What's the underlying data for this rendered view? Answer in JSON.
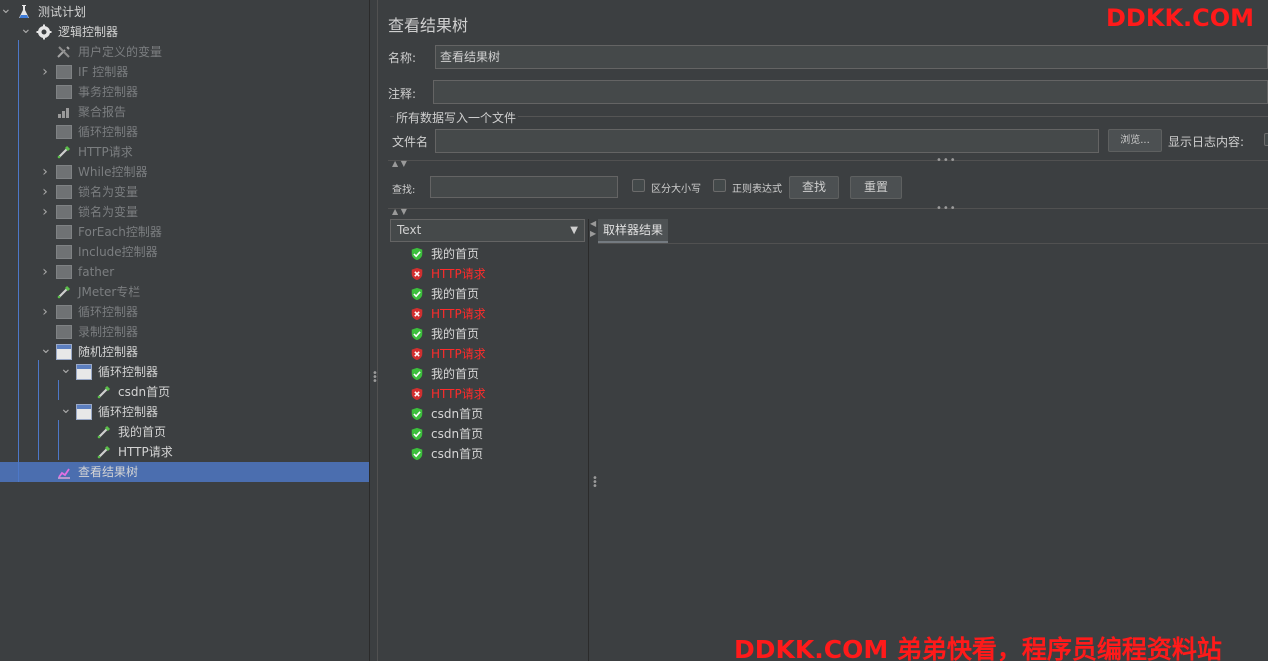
{
  "tree": {
    "items": [
      {
        "label": "测试计划",
        "level": 0,
        "expanded": true,
        "icon": "flask-icon",
        "style": "bright"
      },
      {
        "label": "逻辑控制器",
        "level": 1,
        "expanded": true,
        "icon": "gear-icon",
        "style": "bright"
      },
      {
        "label": "用户定义的变量",
        "level": 2,
        "expandable": false,
        "icon": "wrench-icon",
        "style": "dim"
      },
      {
        "label": "IF 控制器",
        "level": 2,
        "expandable": true,
        "expanded": false,
        "icon": "box-icon",
        "style": "dim"
      },
      {
        "label": "事务控制器",
        "level": 2,
        "expandable": false,
        "icon": "box-icon",
        "style": "dim"
      },
      {
        "label": "聚合报告",
        "level": 2,
        "expandable": false,
        "icon": "chart-icon",
        "style": "dim"
      },
      {
        "label": "循环控制器",
        "level": 2,
        "expandable": false,
        "icon": "box-icon",
        "style": "dim"
      },
      {
        "label": "HTTP请求",
        "level": 2,
        "expandable": false,
        "icon": "pipette-icon",
        "style": "dim"
      },
      {
        "label": "While控制器",
        "level": 2,
        "expandable": true,
        "expanded": false,
        "icon": "box-icon",
        "style": "dim"
      },
      {
        "label": "锁名为变量",
        "level": 2,
        "expandable": true,
        "expanded": false,
        "icon": "box-icon",
        "style": "dim"
      },
      {
        "label": "锁名为变量",
        "level": 2,
        "expandable": true,
        "expanded": false,
        "icon": "box-icon",
        "style": "dim"
      },
      {
        "label": "ForEach控制器",
        "level": 2,
        "expandable": false,
        "icon": "box-icon",
        "style": "dim"
      },
      {
        "label": "Include控制器",
        "level": 2,
        "expandable": false,
        "icon": "box-icon",
        "style": "dim"
      },
      {
        "label": "father",
        "level": 2,
        "expandable": true,
        "expanded": false,
        "icon": "box-icon",
        "style": "dim"
      },
      {
        "label": "JMeter专栏",
        "level": 2,
        "expandable": false,
        "icon": "pipette-icon",
        "style": "dim"
      },
      {
        "label": "循环控制器",
        "level": 2,
        "expandable": true,
        "expanded": false,
        "icon": "box-icon",
        "style": "dim"
      },
      {
        "label": "录制控制器",
        "level": 2,
        "expandable": false,
        "icon": "box-icon",
        "style": "dim"
      },
      {
        "label": "随机控制器",
        "level": 2,
        "expandable": true,
        "expanded": true,
        "icon": "window-icon",
        "style": "bright"
      },
      {
        "label": "循环控制器",
        "level": 3,
        "expandable": true,
        "expanded": true,
        "icon": "window-icon",
        "style": "bright"
      },
      {
        "label": "csdn首页",
        "level": 4,
        "expandable": false,
        "icon": "pipette-icon",
        "style": "bright"
      },
      {
        "label": "循环控制器",
        "level": 3,
        "expandable": true,
        "expanded": true,
        "icon": "window-icon",
        "style": "bright"
      },
      {
        "label": "我的首页",
        "level": 4,
        "expandable": false,
        "icon": "pipette-icon",
        "style": "bright"
      },
      {
        "label": "HTTP请求",
        "level": 4,
        "expandable": false,
        "icon": "pipette-icon",
        "style": "bright"
      },
      {
        "label": "查看结果树",
        "level": 2,
        "expandable": false,
        "icon": "listener-icon",
        "style": "bright",
        "selected": true
      }
    ]
  },
  "panel": {
    "title": "查看结果树",
    "name_label": "名称:",
    "name_value": "查看结果树",
    "comment_label": "注释:",
    "comment_value": "",
    "file_group_title": "所有数据写入一个文件",
    "filename_label": "文件名",
    "filename_value": "",
    "browse_label": "浏览...",
    "log_label": "显示日志内容:",
    "search_label": "查找:",
    "search_value": "",
    "case_label": "区分大小写",
    "regex_label": "正则表达式",
    "find_button": "查找",
    "reset_button": "重置"
  },
  "renderer": {
    "selected": "Text"
  },
  "results": [
    {
      "label": "我的首页",
      "status": "ok"
    },
    {
      "label": "HTTP请求",
      "status": "error"
    },
    {
      "label": "我的首页",
      "status": "ok"
    },
    {
      "label": "HTTP请求",
      "status": "error"
    },
    {
      "label": "我的首页",
      "status": "ok"
    },
    {
      "label": "HTTP请求",
      "status": "error"
    },
    {
      "label": "我的首页",
      "status": "ok"
    },
    {
      "label": "HTTP请求",
      "status": "error"
    },
    {
      "label": "csdn首页",
      "status": "ok"
    },
    {
      "label": "csdn首页",
      "status": "ok"
    },
    {
      "label": "csdn首页",
      "status": "ok"
    }
  ],
  "tabs": [
    {
      "label": "取样器结果"
    }
  ],
  "watermarks": {
    "top": "DDKK.COM",
    "bottom": "DDKK.COM 弟弟快看，程序员编程资料站"
  },
  "colors": {
    "selection": "#4b6eaf",
    "error_text": "#ff2b2b",
    "ok_icon": "#3dbf3d",
    "error_icon": "#d23030",
    "watermark": "#ff1a1a"
  }
}
